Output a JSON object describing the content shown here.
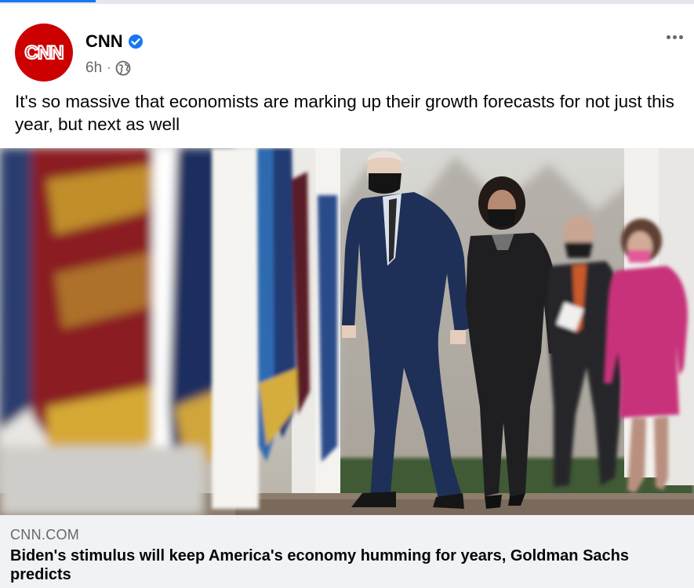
{
  "post": {
    "author": "CNN",
    "avatar_logo_text": "CNN",
    "time": "6h",
    "separator": "·",
    "privacy_icon": "globe-icon",
    "verified_icon": "verified-badge-icon",
    "more_icon": "more-options-icon",
    "text": "It's so massive that economists are marking up their growth forecasts for not just this year, but next as well"
  },
  "link_preview": {
    "domain": "CNN.COM",
    "headline": "Biden's stimulus will keep America's economy humming for years, Goldman Sachs predicts"
  },
  "colors": {
    "cnn_red": "#cc0000",
    "verified_blue": "#1877f2",
    "link_card_bg": "#f0f2f5",
    "meta_gray": "#65676b",
    "suit_navy": "#1e3057",
    "dress_magenta": "#c8327a"
  }
}
